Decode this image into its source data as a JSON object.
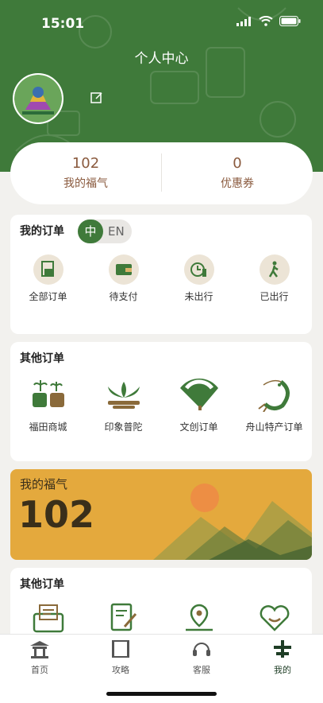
{
  "status_bar": {
    "time": "15:01"
  },
  "header": {
    "title": "个人中心"
  },
  "stats": [
    {
      "value": "102",
      "label": "我的福气"
    },
    {
      "value": "0",
      "label": "优惠券"
    }
  ],
  "my_orders": {
    "title": "我的订单",
    "lang_toggle": {
      "active": "中",
      "inactive": "EN"
    },
    "items": [
      {
        "label": "全部订单",
        "icon": "receipt-icon"
      },
      {
        "label": "待支付",
        "icon": "wallet-icon"
      },
      {
        "label": "未出行",
        "icon": "clock-person-icon"
      },
      {
        "label": "已出行",
        "icon": "walking-icon"
      }
    ]
  },
  "other_orders_1": {
    "title": "其他订单",
    "items": [
      {
        "label": "福田商城",
        "icon": "farmland-icon"
      },
      {
        "label": "印象普陀",
        "icon": "lotus-icon"
      },
      {
        "label": "文创订单",
        "icon": "fan-icon"
      },
      {
        "label": "舟山特产订单",
        "icon": "shrimp-icon"
      }
    ]
  },
  "fuqi_card": {
    "label": "我的福气",
    "value": "102"
  },
  "other_orders_2": {
    "title": "其他订单",
    "items": [
      {
        "icon": "inbox-icon"
      },
      {
        "icon": "document-edit-icon"
      },
      {
        "icon": "map-pin-icon"
      },
      {
        "icon": "heart-smile-icon"
      }
    ]
  },
  "tabbar": [
    {
      "label": "首页",
      "icon": "pavilion-icon"
    },
    {
      "label": "攻略",
      "icon": "scroll-icon"
    },
    {
      "label": "客服",
      "icon": "headset-icon"
    },
    {
      "label": "我的",
      "icon": "profile-icon",
      "active": true
    }
  ],
  "colors": {
    "brand": "#3f7a3a",
    "accent": "#e4a93d",
    "text_brown": "#8a5a3e"
  }
}
